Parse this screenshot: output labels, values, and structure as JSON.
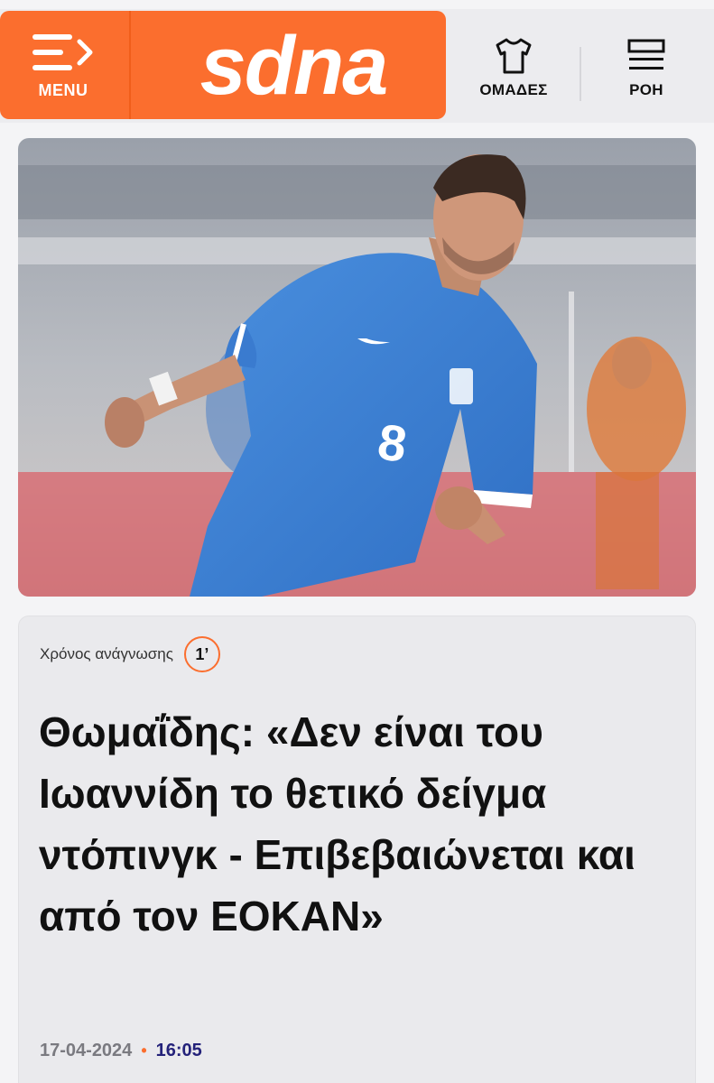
{
  "header": {
    "menu_label": "MENU",
    "logo_text": "sdna",
    "teams_label": "ΟΜΑΔΕΣ",
    "feed_label": "ΡΟΗ",
    "brand_color": "#fb6e2e"
  },
  "hero": {
    "jersey_number": "8"
  },
  "article": {
    "read_time_label": "Χρόνος ανάγνωσης",
    "read_time_value": "1’",
    "headline": "Θωμαΐδης: «Δεν είναι του Ιωαννίδη το θετικό δείγμα ντόπινγκ - Επιβεβαιώνεται και από τον ΕΟΚΑΝ»",
    "date": "17-04-2024",
    "separator": "•",
    "time": "16:05"
  },
  "icons": {
    "menu": "menu-arrow-icon",
    "teams": "jersey-icon",
    "feed": "feed-lines-icon"
  }
}
